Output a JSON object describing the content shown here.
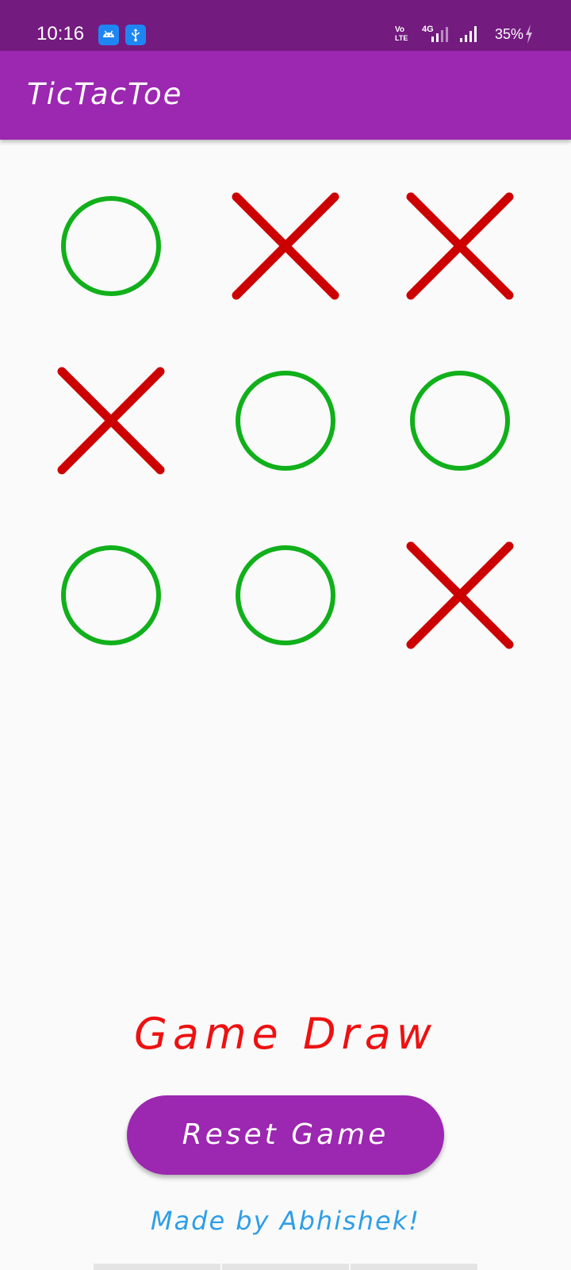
{
  "status_bar": {
    "time": "10:16",
    "battery_percent": "35%",
    "notification_icons": [
      "android-icon",
      "usb-icon"
    ],
    "network_icons": [
      "volte-icon",
      "4g-signal-icon",
      "signal-icon",
      "charging-icon"
    ]
  },
  "app_bar": {
    "title": "TicTacToe",
    "color": "#9c27b0"
  },
  "board": {
    "cells": [
      "O",
      "X",
      "X",
      "X",
      "O",
      "O",
      "O",
      "O",
      "X"
    ],
    "x_color": "#cc0000",
    "o_color": "#11b01b"
  },
  "game": {
    "status": "Game Draw",
    "status_color": "#ee1111"
  },
  "reset_button": {
    "label": "Reset Game"
  },
  "footer": {
    "credit": "Made by Abhishek!"
  }
}
